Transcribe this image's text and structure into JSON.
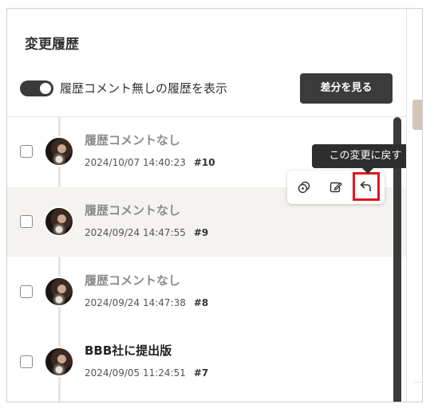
{
  "panel": {
    "title": "変更履歴",
    "toggle_label": "履歴コメント無しの履歴を表示",
    "toggle_on": true,
    "diff_button_label": "差分を見る"
  },
  "history": [
    {
      "comment": "履歴コメントなし",
      "datetime": "2024/10/07 14:40:23",
      "revision": "#10"
    },
    {
      "comment": "履歴コメントなし",
      "datetime": "2024/09/24 14:47:55",
      "revision": "#9"
    },
    {
      "comment": "履歴コメントなし",
      "datetime": "2024/09/24 14:47:38",
      "revision": "#8"
    },
    {
      "comment": "BBB社に提出版",
      "datetime": "2024/09/05 11:24:51",
      "revision": "#7"
    }
  ],
  "actions": {
    "icons": [
      "copy-icon",
      "edit-icon",
      "undo-icon"
    ],
    "tooltip": "この変更に戻す"
  },
  "colors": {
    "dark": "#3b3b3b",
    "highlight_row": "#f5f3ef",
    "callout_red": "#e3141b"
  }
}
